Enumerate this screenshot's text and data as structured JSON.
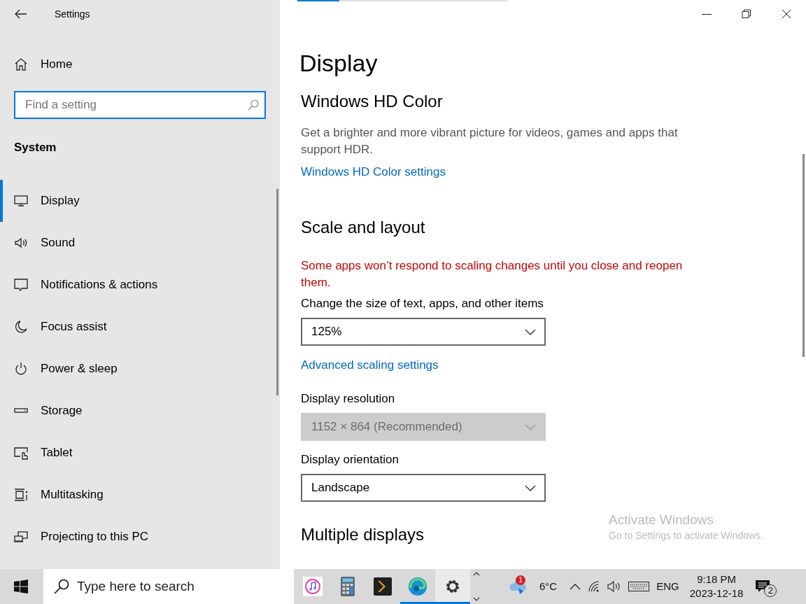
{
  "window": {
    "title": "Settings"
  },
  "loading_bar": {
    "level": 0.2
  },
  "sidebar": {
    "home": "Home",
    "search": {
      "placeholder": "Find a setting"
    },
    "group": "System",
    "items": [
      {
        "label": "Display",
        "selected": true
      },
      {
        "label": "Sound",
        "selected": false
      },
      {
        "label": "Notifications & actions",
        "selected": false
      },
      {
        "label": "Focus assist",
        "selected": false
      },
      {
        "label": "Power & sleep",
        "selected": false
      },
      {
        "label": "Storage",
        "selected": false
      },
      {
        "label": "Tablet",
        "selected": false
      },
      {
        "label": "Multitasking",
        "selected": false
      },
      {
        "label": "Projecting to this PC",
        "selected": false
      }
    ]
  },
  "page_title": "Display",
  "sections": [
    {
      "title": "Windows HD Color",
      "items": [
        {
          "kind": "text",
          "text": "Get a brighter and more vibrant picture for videos, games and apps that support HDR."
        },
        {
          "kind": "link",
          "text": "Windows HD Color settings"
        }
      ]
    },
    {
      "title": "Scale and layout",
      "items": [
        {
          "kind": "warning",
          "text": "Some apps won’t respond to scaling changes until you close and reopen them."
        },
        {
          "kind": "dropdown",
          "label": "Change the size of text, apps, and other items",
          "value": "125%",
          "disabled": false
        },
        {
          "kind": "link",
          "text": "Advanced scaling settings"
        },
        {
          "kind": "dropdown",
          "label": "Display resolution",
          "value": "1152 × 864 (Recommended)",
          "disabled": true
        },
        {
          "kind": "dropdown",
          "label": "Display orientation",
          "value": "Landscape",
          "disabled": false
        }
      ]
    },
    {
      "title": "Multiple displays"
    }
  ],
  "activation_notice": {
    "title": "Activate Windows",
    "text": "Go to Settings to activate Windows."
  },
  "taskbar": {
    "search": {
      "placeholder": "Type here to search"
    },
    "apps": [
      {
        "running": false,
        "selected": false
      },
      {
        "running": false,
        "selected": false
      },
      {
        "running": false,
        "selected": false
      },
      {
        "running": true,
        "selected": false
      },
      {
        "running": true,
        "selected": true
      }
    ],
    "weather": {
      "badge": "1",
      "temperature": "6°C"
    },
    "language": "ENG",
    "time": "9:18 PM",
    "date": "2023-12-18",
    "notifications": "2"
  }
}
